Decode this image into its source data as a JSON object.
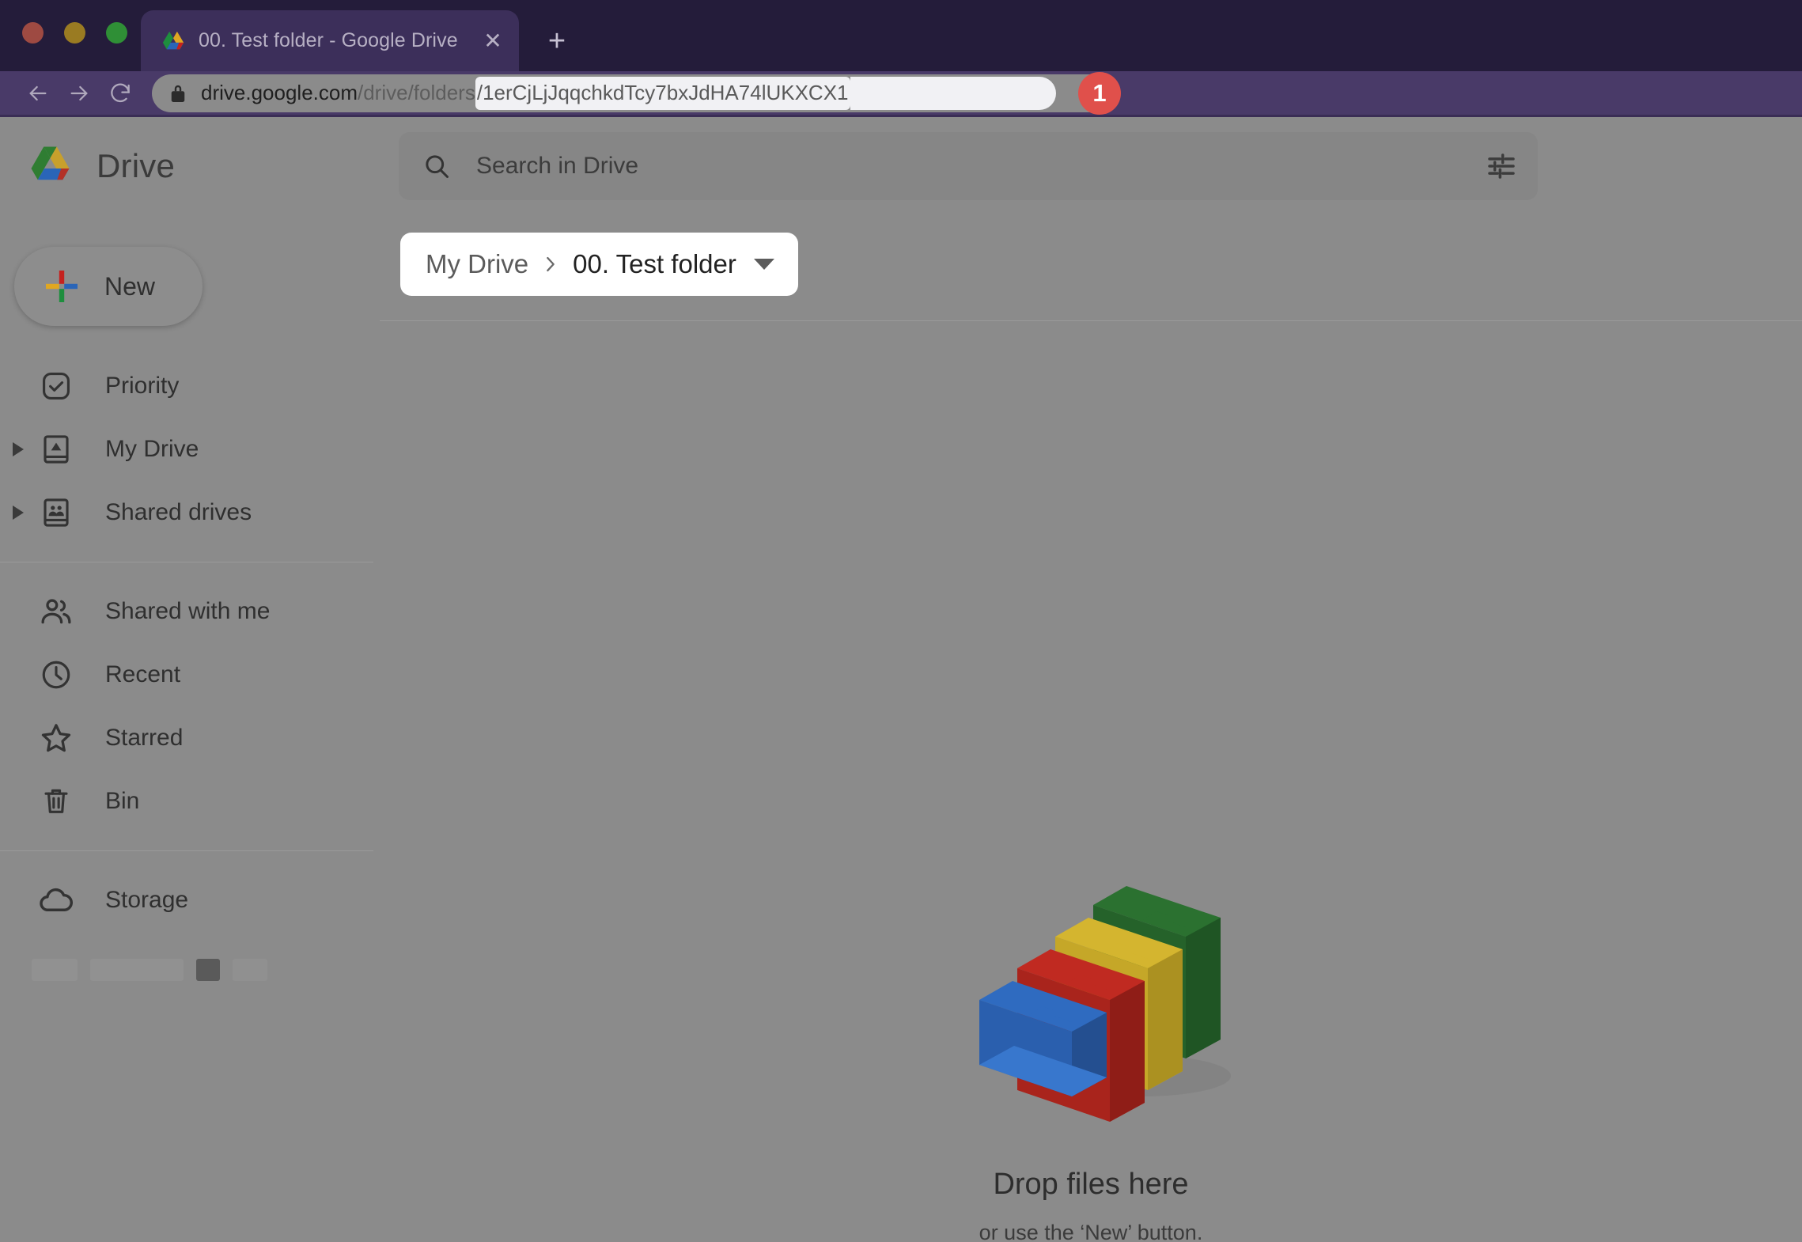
{
  "browser": {
    "window_controls": [
      "close",
      "minimize",
      "maximize"
    ],
    "tab": {
      "title": "00. Test folder - Google Drive",
      "favicon_name": "google-drive-favicon",
      "close_label": "✕"
    },
    "new_tab_label": "+",
    "nav": {
      "back_label": "Back",
      "forward_label": "Forward",
      "reload_label": "Reload"
    },
    "omnibox": {
      "lock_name": "site-secure-lock-icon",
      "url_host": "drive.google.com",
      "url_path": "/drive/folders",
      "url_selected": "/1erCjLjJqqchkdTcy7bxJdHA74lUKXCX1",
      "full_url": "drive.google.com/drive/folders/1erCjLjJqqchkdTcy7bxJdHA74lUKXCX1"
    },
    "annotation_badge": {
      "number": "1",
      "color": "#e0504b"
    }
  },
  "drive": {
    "brand": {
      "name": "Drive",
      "logo_name": "google-drive-logo"
    },
    "search": {
      "placeholder": "Search in Drive",
      "value": "",
      "search_icon": "search-icon",
      "options_icon": "tune-icon"
    },
    "new_button": {
      "label": "New",
      "icon": "colored-plus-icon"
    },
    "sidebar": {
      "items": [
        {
          "label": "Priority",
          "icon": "check-box-circle-icon",
          "expandable": false
        },
        {
          "label": "My Drive",
          "icon": "my-drive-icon",
          "expandable": true
        },
        {
          "label": "Shared drives",
          "icon": "shared-drives-icon",
          "expandable": true
        },
        {
          "label": "Shared with me",
          "icon": "people-icon",
          "expandable": false
        },
        {
          "label": "Recent",
          "icon": "clock-icon",
          "expandable": false
        },
        {
          "label": "Starred",
          "icon": "star-icon",
          "expandable": false
        },
        {
          "label": "Bin",
          "icon": "trash-icon",
          "expandable": false
        },
        {
          "label": "Storage",
          "icon": "cloud-icon",
          "expandable": false
        }
      ]
    },
    "breadcrumb": {
      "parent": "My Drive",
      "separator": "›",
      "current": "00. Test folder",
      "dropdown_icon": "chevron-down-icon"
    },
    "empty_state": {
      "illustration": "stacked-folders-illustration",
      "title": "Drop files here",
      "subtitle": "or use the ‘New’ button.",
      "folder_colors": [
        "#2f7d32",
        "#d5b52e",
        "#bf2b21",
        "#2a65b8"
      ]
    }
  },
  "theme": {
    "tabstrip_bg": "#241c3a",
    "tab_active_bg": "#3c2f5a",
    "toolbar_bg": "#493a68",
    "page_dim_bg": "#8b8b8b",
    "breadcrumb_bg": "#ffffff"
  }
}
